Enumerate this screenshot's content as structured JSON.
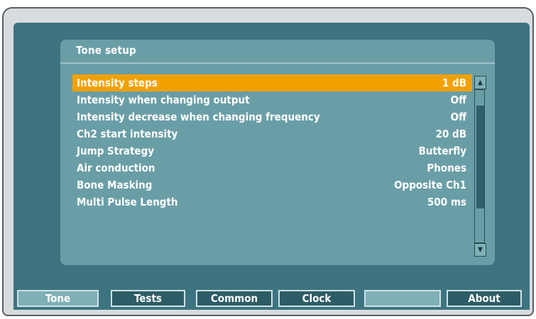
{
  "panel": {
    "title": "Tone setup",
    "rows": [
      {
        "label": "Intensity steps",
        "value": "1 dB"
      },
      {
        "label": "Intensity when changing output",
        "value": "Off"
      },
      {
        "label": "Intensity decrease when changing frequency",
        "value": "Off"
      },
      {
        "label": "Ch2 start intensity",
        "value": "20 dB"
      },
      {
        "label": "Jump Strategy",
        "value": "Butterfly"
      },
      {
        "label": "Air conduction",
        "value": "Phones"
      },
      {
        "label": "Bone Masking",
        "value": "Opposite Ch1"
      },
      {
        "label": "Multi Pulse Length",
        "value": "500 ms"
      }
    ],
    "selected_index": 0
  },
  "tabs": [
    {
      "label": "Tone"
    },
    {
      "label": "Tests"
    },
    {
      "label": "Common"
    },
    {
      "label": "Clock"
    },
    {
      "label": ""
    },
    {
      "label": "About"
    }
  ],
  "icons": {
    "scroll_up": "triangle-up-icon",
    "scroll_down": "triangle-down-icon"
  },
  "colors": {
    "screen": "#3d7480",
    "panel": "#6a9ea6",
    "selection": "#f4a100",
    "text": "#ffffff"
  }
}
